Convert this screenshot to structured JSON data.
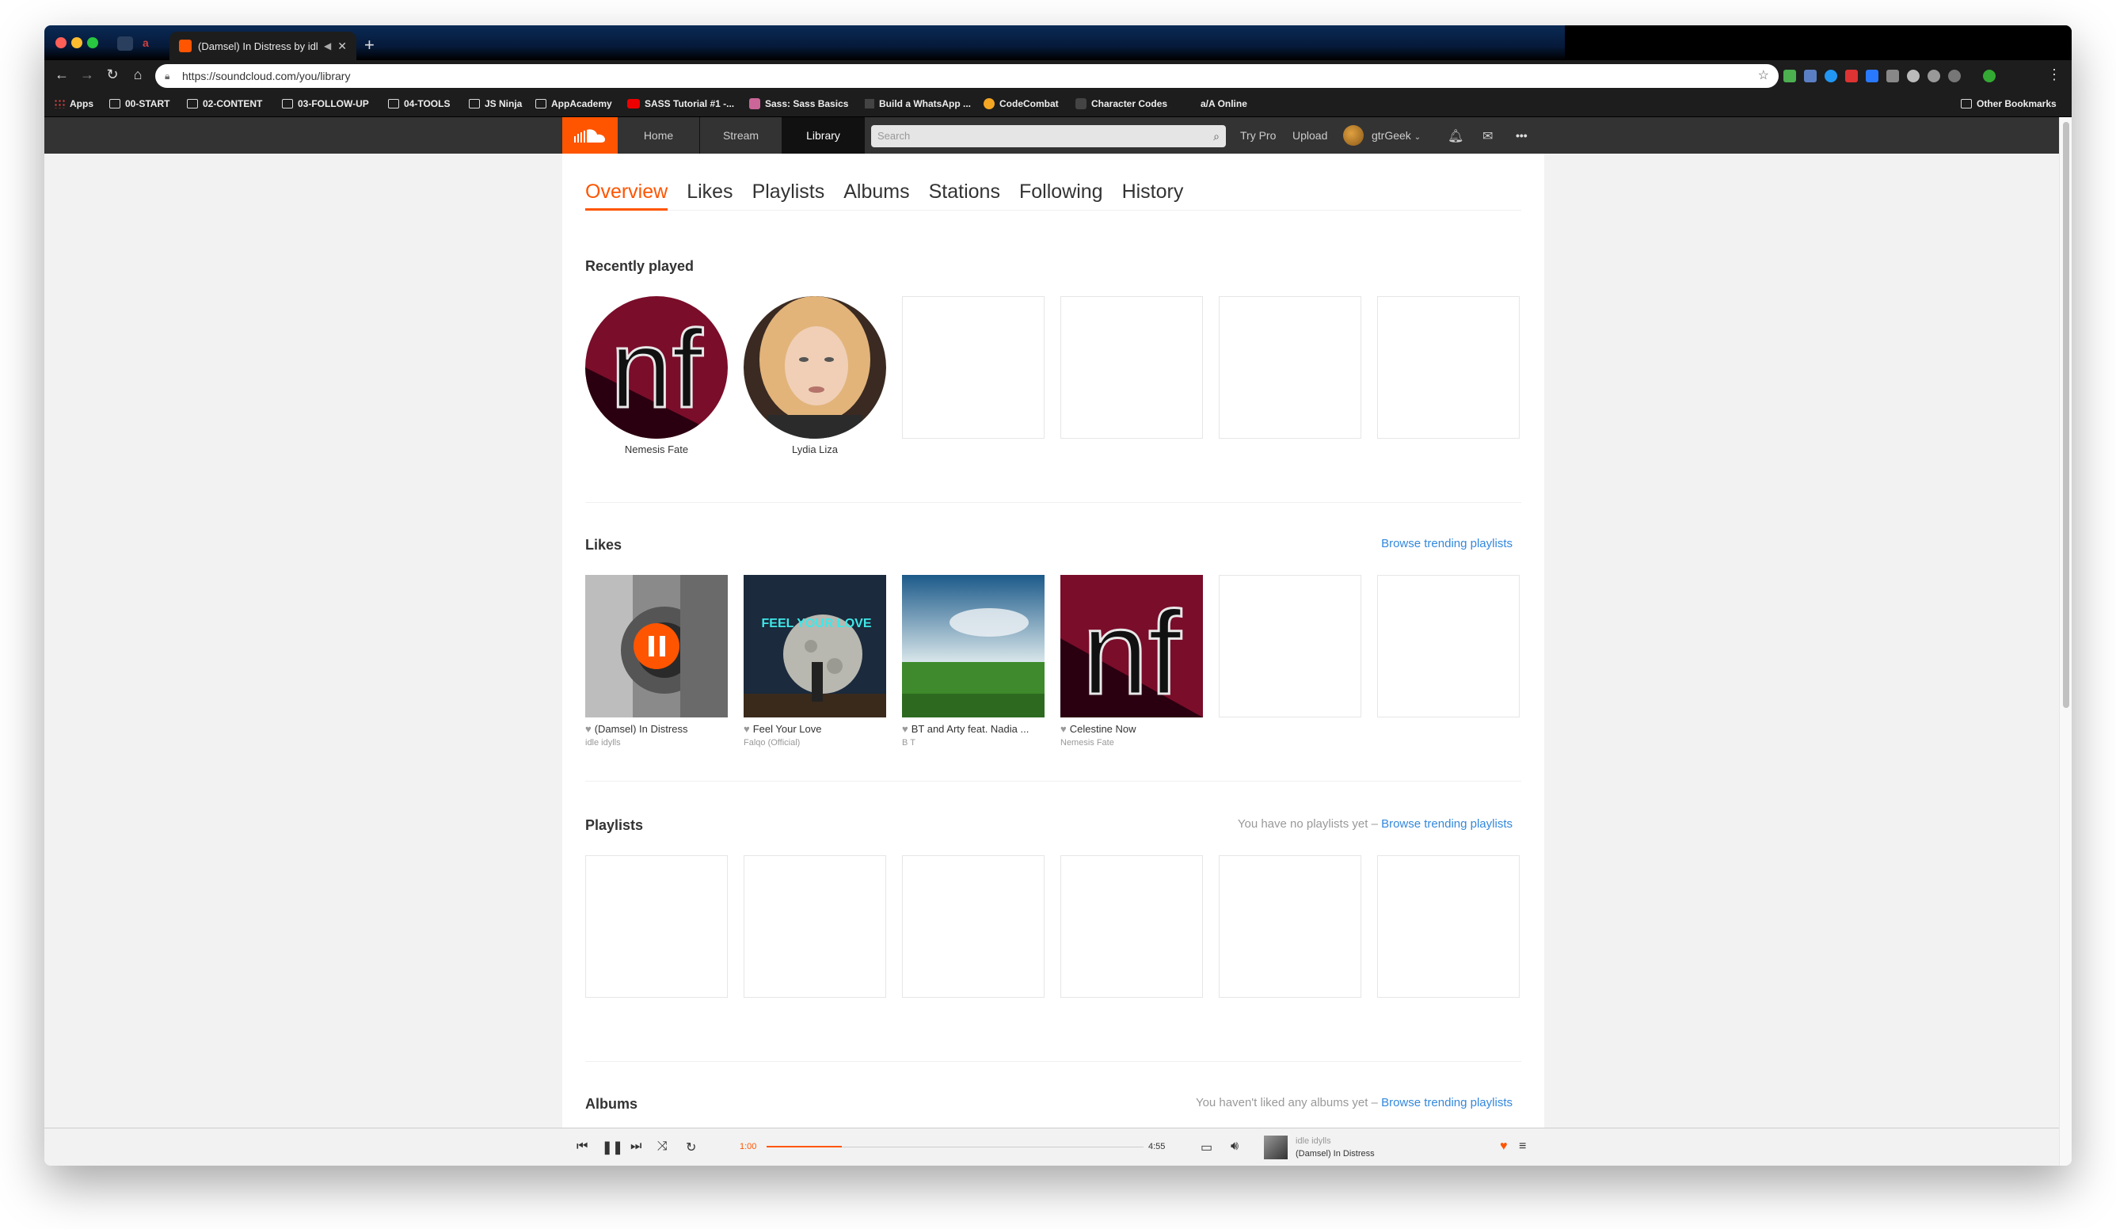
{
  "browser": {
    "tab_title": "(Damsel) In Distress by idl",
    "new_tab": "+",
    "url": "https://soundcloud.com/you/library",
    "bookmarks": [
      "Apps",
      "00-START",
      "02-CONTENT",
      "03-FOLLOW-UP",
      "04-TOOLS",
      "JS Ninja",
      "AppAcademy",
      "SASS Tutorial #1 -...",
      "Sass: Sass Basics",
      "Build a WhatsApp ...",
      "CodeCombat",
      "Character Codes",
      "a/A Online"
    ],
    "other_bookmarks": "Other Bookmarks"
  },
  "header": {
    "nav": [
      "Home",
      "Stream",
      "Library"
    ],
    "search_placeholder": "Search",
    "try_pro": "Try Pro",
    "upload": "Upload",
    "username": "gtrGeek",
    "more": "•••"
  },
  "library": {
    "tabs": [
      "Overview",
      "Likes",
      "Playlists",
      "Albums",
      "Stations",
      "Following",
      "History"
    ],
    "recently_played": {
      "title": "Recently played",
      "items": [
        {
          "name": "Nemesis Fate"
        },
        {
          "name": "Lydia Liza"
        }
      ]
    },
    "likes": {
      "title": "Likes",
      "link": "Browse trending playlists",
      "items": [
        {
          "title": "(Damsel) In Distress",
          "artist": "idle idylls"
        },
        {
          "title": "Feel Your Love",
          "artist": "Falqo (Official)"
        },
        {
          "title": "BT and Arty feat. Nadia ...",
          "artist": "B T"
        },
        {
          "title": "Celestine Now",
          "artist": "Nemesis Fate"
        }
      ],
      "art_text_nf": "nf",
      "art_text_falqo": "FEEL YOUR LOVE"
    },
    "playlists": {
      "title": "Playlists",
      "empty_text": "You have no playlists yet – ",
      "link": "Browse trending playlists"
    },
    "albums": {
      "title": "Albums",
      "empty_text": "You haven't liked any albums yet – ",
      "link": "Browse trending playlists"
    },
    "nf_art_text": "nf"
  },
  "player": {
    "elapsed": "1:00",
    "duration": "4:55",
    "progress_fraction": 0.2,
    "artist": "idle idylls",
    "track": "(Damsel) In Distress"
  },
  "colors": {
    "accent": "#ff5500",
    "link": "#3388dd"
  }
}
